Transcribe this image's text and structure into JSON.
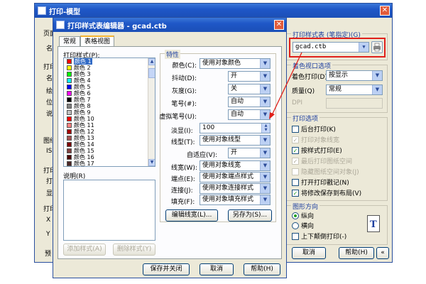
{
  "back_window": {
    "title": "打印-模型",
    "left_labels": [
      "页面",
      "名",
      "打印",
      "名",
      "绘",
      "位",
      "说",
      "图纸",
      "IS",
      "打印",
      "打",
      "显",
      "打印",
      "X",
      "Y",
      "预"
    ],
    "style_table_group": "打印样式表 (笔指定)(G)",
    "style_table_value": "gcad.ctb",
    "shaded_group": "着色视口选项",
    "shaded_print_label": "着色打印(D)",
    "shaded_print_value": "按显示",
    "quality_label": "质量(Q)",
    "quality_value": "常规",
    "dpi_label": "DPI",
    "options_group": "打印选项",
    "options": [
      {
        "label": "后台打印(K)",
        "checked": false,
        "disabled": false
      },
      {
        "label": "打印对象线宽",
        "checked": true,
        "disabled": true
      },
      {
        "label": "按样式打印(E)",
        "checked": true,
        "disabled": false
      },
      {
        "label": "最后打印图纸空间",
        "checked": true,
        "disabled": true
      },
      {
        "label": "隐藏图纸空间对象(J)",
        "checked": false,
        "disabled": true
      },
      {
        "label": "打开打印戳记(N)",
        "checked": false,
        "disabled": false
      },
      {
        "label": "将修改保存到布局(V)",
        "checked": true,
        "disabled": false
      }
    ],
    "orientation_group": "图形方向",
    "portrait": "纵向",
    "landscape": "横向",
    "upside_down": "上下颠倒打印(-)",
    "btn_cancel": "取消",
    "btn_help": "帮助(H)",
    "btn_collapse": "«"
  },
  "editor": {
    "title": "打印样式表编辑器 - gcad.ctb",
    "tabs": [
      "常规",
      "表格视图"
    ],
    "styles_label": "打印样式(P):",
    "styles": [
      {
        "name": "颜色 1",
        "color": "#ff0000"
      },
      {
        "name": "颜色 2",
        "color": "#ffff00"
      },
      {
        "name": "颜色 3",
        "color": "#00ff00"
      },
      {
        "name": "颜色 4",
        "color": "#00ffff"
      },
      {
        "name": "颜色 5",
        "color": "#0000ff"
      },
      {
        "name": "颜色 6",
        "color": "#ff00ff"
      },
      {
        "name": "颜色 7",
        "color": "#000000"
      },
      {
        "name": "颜色 8",
        "color": "#808080"
      },
      {
        "name": "颜色 9",
        "color": "#c0c0c0"
      },
      {
        "name": "颜色 10",
        "color": "#ff0000"
      },
      {
        "name": "颜色 11",
        "color": "#ff7f7f"
      },
      {
        "name": "颜色 12",
        "color": "#a50000"
      },
      {
        "name": "颜色 13",
        "color": "#a55252"
      },
      {
        "name": "颜色 14",
        "color": "#7f0000"
      },
      {
        "name": "颜色 15",
        "color": "#7f3f3f"
      },
      {
        "name": "颜色 16",
        "color": "#4c0000"
      },
      {
        "name": "颜色 17",
        "color": "#4c2626"
      }
    ],
    "desc_label": "说明(R)",
    "btn_add": "添加样式(A)",
    "btn_delete": "删除样式(Y)",
    "props_group": "特性",
    "props": [
      {
        "label": "颜色(C):",
        "value": "使用对象颜色"
      },
      {
        "label": "抖动(D):",
        "value": "开"
      },
      {
        "label": "灰度(G):",
        "value": "关"
      },
      {
        "label": "笔号(#):",
        "value": "自动"
      },
      {
        "label": "虚拟笔号(U):",
        "value": "自动"
      }
    ],
    "screening_label": "淡显(I):",
    "screening_value": "100",
    "linetype_label": "线型(T):",
    "linetype_value": "使用对象线型",
    "adaptive_label": "自适应(V):",
    "adaptive_value": "开",
    "lineweight_label": "线宽(W):",
    "lineweight_value": "使用对象线宽",
    "endstyle_label": "端点(E):",
    "endstyle_value": "使用对象端点样式",
    "joinstyle_label": "连接(J):",
    "joinstyle_value": "使用对象连接样式",
    "fillstyle_label": "填充(F):",
    "fillstyle_value": "使用对象填充样式",
    "btn_edit_lw": "编辑线宽(L)...",
    "btn_save_as": "另存为(S)...",
    "btn_save_close": "保存并关闭",
    "btn_cancel": "取消",
    "btn_help": "帮助(H)"
  }
}
